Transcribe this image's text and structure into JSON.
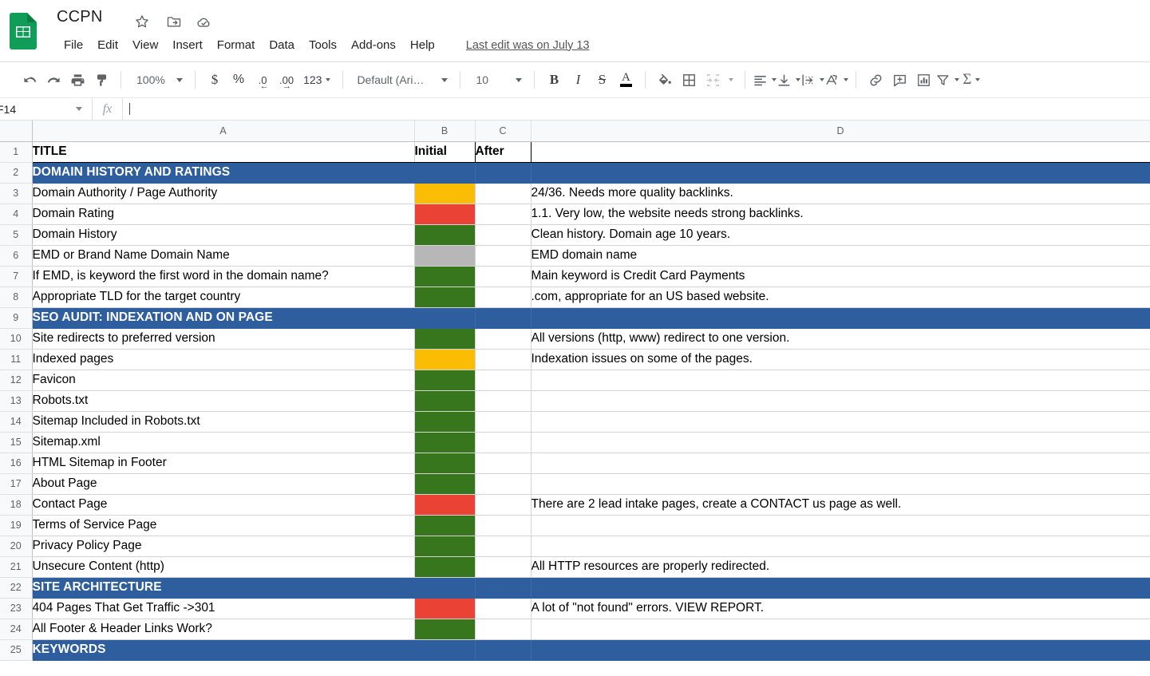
{
  "app": {
    "logo_icon": "sheets-logo-icon",
    "doc_title": "CCPN",
    "title_icons": [
      {
        "name": "star-icon",
        "glyph": "☆"
      },
      {
        "name": "move-to-folder-icon",
        "glyph": "folder"
      },
      {
        "name": "cloud-saved-icon",
        "glyph": "cloud"
      }
    ],
    "last_edit": "Last edit was on July 13"
  },
  "menubar": {
    "items": [
      {
        "label": "File"
      },
      {
        "label": "Edit"
      },
      {
        "label": "View"
      },
      {
        "label": "Insert"
      },
      {
        "label": "Format"
      },
      {
        "label": "Data"
      },
      {
        "label": "Tools"
      },
      {
        "label": "Add-ons"
      },
      {
        "label": "Help"
      }
    ]
  },
  "toolbar": {
    "undo": "undo-icon",
    "redo": "redo-icon",
    "print": "print-icon",
    "paint_format": "paint-format-icon",
    "zoom_value": "100%",
    "currency": "$",
    "percent": "%",
    "decrease_decimal": ".0",
    "increase_decimal": ".00",
    "more_formats": "123",
    "font_value": "Default (Ari…",
    "font_size_value": "10",
    "bold": "B",
    "italic": "I",
    "strikethrough": "S",
    "text_color": "A",
    "text_color_swatch": "#000000",
    "fill_color": "fill-color-icon",
    "borders": "borders-icon",
    "merge_cells": "merge-cells-icon",
    "horizontal_align": "horizontal-align-icon",
    "vertical_align": "vertical-align-icon",
    "text_wrap": "text-wrap-icon",
    "text_rotation": "text-rotation-icon",
    "insert_link": "insert-link-icon",
    "insert_comment": "insert-comment-icon",
    "insert_chart": "insert-chart-icon",
    "filter": "filter-icon",
    "functions": "Σ"
  },
  "formula_bar": {
    "name_box_value": "F14",
    "fx_label": "fx",
    "formula_value": ""
  },
  "grid": {
    "columns": [
      "A",
      "B",
      "C",
      "D"
    ],
    "header_row": {
      "num": "1",
      "a": "TITLE",
      "b": "Initial",
      "c": "After",
      "d": ""
    },
    "rows": [
      {
        "num": "2",
        "type": "section",
        "a": "DOMAIN HISTORY AND RATINGS",
        "b": "",
        "c": "",
        "d": ""
      },
      {
        "num": "3",
        "type": "data",
        "a": "Domain Authority / Page Authority",
        "status": "yellow",
        "c": "",
        "d": "24/36. Needs more quality backlinks."
      },
      {
        "num": "4",
        "type": "data",
        "a": "Domain Rating",
        "status": "red",
        "c": "",
        "d": "1.1. Very low, the website needs strong backlinks."
      },
      {
        "num": "5",
        "type": "data",
        "a": "Domain History",
        "status": "green",
        "c": "",
        "d": "Clean history. Domain age 10 years."
      },
      {
        "num": "6",
        "type": "data",
        "a": "EMD or Brand Name Domain Name",
        "status": "gray",
        "c": "",
        "d": "EMD domain name"
      },
      {
        "num": "7",
        "type": "data",
        "a": "If EMD, is keyword the first word in the domain name?",
        "status": "green",
        "c": "",
        "d": "Main keyword is Credit Card Payments"
      },
      {
        "num": "8",
        "type": "data",
        "a": "Appropriate TLD for the target country",
        "status": "green",
        "c": "",
        "d": ".com, appropriate for an US based website."
      },
      {
        "num": "9",
        "type": "section",
        "a": "SEO AUDIT: INDEXATION AND ON PAGE",
        "b": "",
        "c": "",
        "d": ""
      },
      {
        "num": "10",
        "type": "data",
        "a": "Site redirects to preferred version",
        "status": "green",
        "c": "",
        "d": "All versions (http, www) redirect to one version."
      },
      {
        "num": "11",
        "type": "data",
        "a": "Indexed pages",
        "status": "yellow",
        "c": "",
        "d": "Indexation issues on some of the pages."
      },
      {
        "num": "12",
        "type": "data",
        "a": "Favicon",
        "status": "green",
        "c": "",
        "d": ""
      },
      {
        "num": "13",
        "type": "data",
        "a": "Robots.txt",
        "status": "green",
        "c": "",
        "d": ""
      },
      {
        "num": "14",
        "type": "data",
        "a": "Sitemap Included in Robots.txt",
        "status": "green",
        "c": "",
        "d": ""
      },
      {
        "num": "15",
        "type": "data",
        "a": "Sitemap.xml",
        "status": "green",
        "c": "",
        "d": ""
      },
      {
        "num": "16",
        "type": "data",
        "a": "HTML Sitemap in Footer",
        "status": "green",
        "c": "",
        "d": ""
      },
      {
        "num": "17",
        "type": "data",
        "a": "About Page",
        "status": "green",
        "c": "",
        "d": ""
      },
      {
        "num": "18",
        "type": "data",
        "a": "Contact Page",
        "status": "red",
        "c": "",
        "d": "There are 2 lead intake pages, create a CONTACT us page as well."
      },
      {
        "num": "19",
        "type": "data",
        "a": "Terms of Service Page",
        "status": "green",
        "c": "",
        "d": ""
      },
      {
        "num": "20",
        "type": "data",
        "a": "Privacy Policy Page",
        "status": "green",
        "c": "",
        "d": ""
      },
      {
        "num": "21",
        "type": "data",
        "a": "Unsecure Content (http)",
        "status": "green",
        "c": "",
        "d": "All HTTP resources are properly redirected."
      },
      {
        "num": "22",
        "type": "section",
        "a": "SITE ARCHITECTURE",
        "b": "",
        "c": "",
        "d": ""
      },
      {
        "num": "23",
        "type": "data",
        "a": "404 Pages That Get Traffic ->301",
        "status": "red",
        "c": "",
        "d": "A lot of \"not found\" errors. VIEW REPORT."
      },
      {
        "num": "24",
        "type": "data",
        "a": "All Footer & Header Links Work?",
        "status": "green",
        "c": "",
        "d": ""
      },
      {
        "num": "25",
        "type": "section",
        "a": "KEYWORDS",
        "b": "",
        "c": "",
        "d": ""
      }
    ]
  },
  "colors": {
    "section_blue": "#2f5e9e",
    "status_green": "#38761d",
    "status_red": "#ea4335",
    "status_yellow": "#fbbc04",
    "status_gray": "#b7b7b7",
    "brand_green": "#0f9d58"
  }
}
